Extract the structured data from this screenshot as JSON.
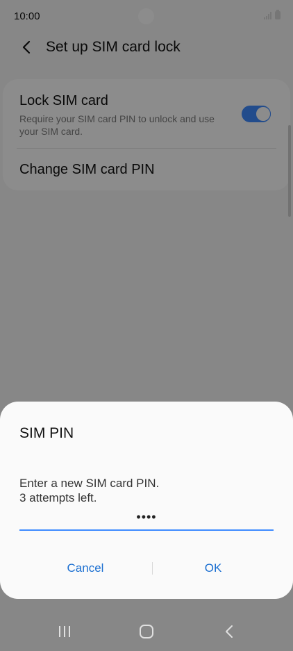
{
  "status_bar": {
    "time": "10:00"
  },
  "app_bar": {
    "title": "Set up SIM card lock"
  },
  "settings": {
    "lock_sim": {
      "title": "Lock SIM card",
      "description": "Require your SIM card PIN to unlock and use your SIM card.",
      "enabled": true
    },
    "change_pin": {
      "title": "Change SIM card PIN"
    }
  },
  "dialog": {
    "title": "SIM PIN",
    "message_line1": "Enter a new SIM card PIN.",
    "message_line2": "3 attempts left.",
    "pin_value": "••••",
    "cancel_label": "Cancel",
    "ok_label": "OK"
  },
  "icons": {
    "back": "chevron-left-icon",
    "recent_apps": "recent-apps-icon",
    "home": "home-icon",
    "nav_back": "back-icon"
  },
  "colors": {
    "accent": "#3e8bff",
    "button_text": "#1b6fd1"
  }
}
